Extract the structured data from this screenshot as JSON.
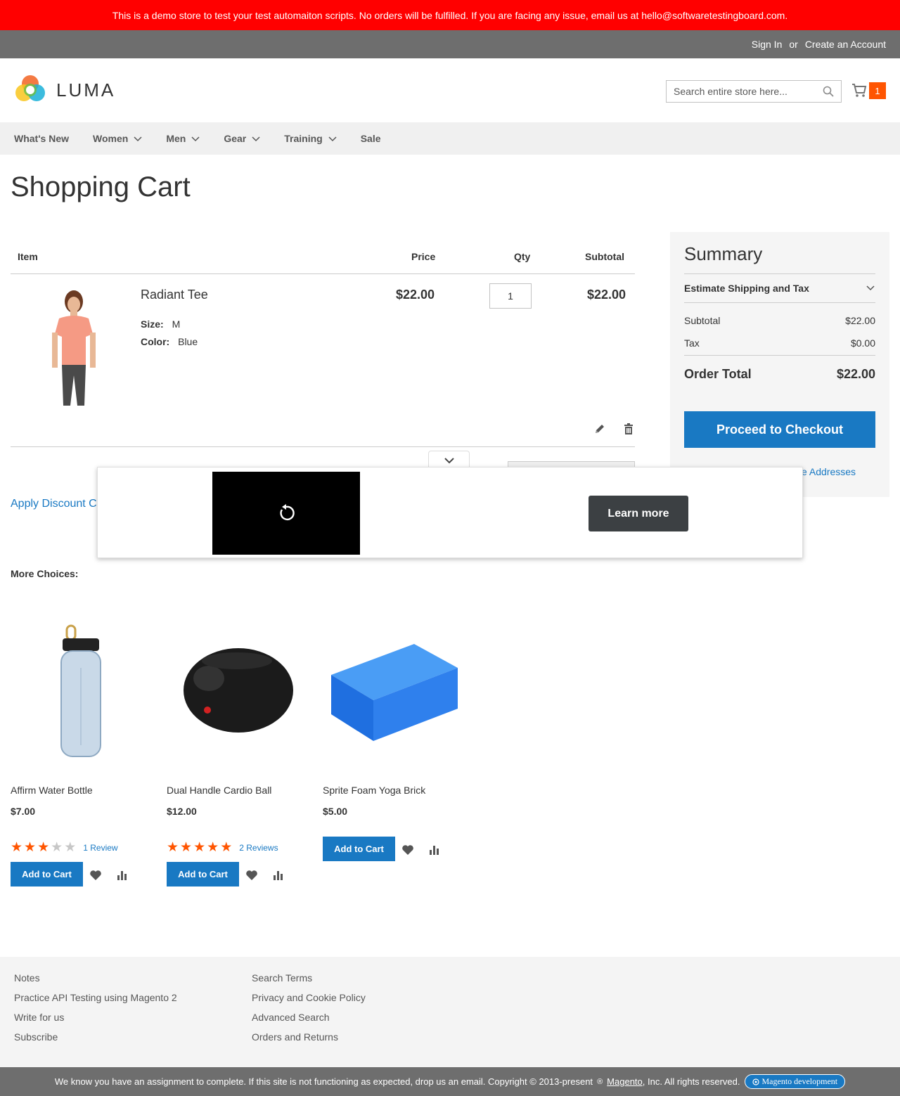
{
  "demo_notice": "This is a demo store to test your test automaiton scripts. No orders will be fulfilled. If you are facing any issue, email us at hello@softwaretestingboard.com.",
  "top_links": {
    "sign_in": "Sign In",
    "or": "or",
    "create_account": "Create an Account"
  },
  "header": {
    "logo_text": "LUMA",
    "search_placeholder": "Search entire store here...",
    "cart_count": "1"
  },
  "nav": {
    "items": [
      {
        "label": "What's New",
        "dropdown": false
      },
      {
        "label": "Women",
        "dropdown": true
      },
      {
        "label": "Men",
        "dropdown": true
      },
      {
        "label": "Gear",
        "dropdown": true
      },
      {
        "label": "Training",
        "dropdown": true
      },
      {
        "label": "Sale",
        "dropdown": false
      }
    ]
  },
  "page_title": "Shopping Cart",
  "cart": {
    "headers": {
      "item": "Item",
      "price": "Price",
      "qty": "Qty",
      "subtotal": "Subtotal"
    },
    "item": {
      "name": "Radiant Tee",
      "size_label": "Size:",
      "size_value": "M",
      "color_label": "Color:",
      "color_value": "Blue",
      "price": "$22.00",
      "qty": "1",
      "subtotal": "$22.00"
    },
    "apply_discount": "Apply Discount C"
  },
  "summary": {
    "title": "Summary",
    "estimate": "Estimate Shipping and Tax",
    "subtotal_label": "Subtotal",
    "subtotal_value": "$22.00",
    "tax_label": "Tax",
    "tax_value": "$0.00",
    "total_label": "Order Total",
    "total_value": "$22.00",
    "checkout": "Proceed to Checkout",
    "multi_address": "e Addresses"
  },
  "ad": {
    "learn_more": "Learn more"
  },
  "more_choices": {
    "title": "More Choices:",
    "products": [
      {
        "name": "Affirm Water Bottle",
        "price": "$7.00",
        "rating": 3,
        "reviews": "1 Review",
        "button": "Add to Cart"
      },
      {
        "name": "Dual Handle Cardio Ball",
        "price": "$12.00",
        "rating": 5,
        "reviews": "2 Reviews",
        "button": "Add to Cart"
      },
      {
        "name": "Sprite Foam Yoga Brick",
        "price": "$5.00",
        "rating": 0,
        "reviews": "",
        "button": "Add to Cart"
      }
    ]
  },
  "footer": {
    "col1": [
      "Notes",
      "Practice API Testing using Magento 2",
      "Write for us",
      "Subscribe"
    ],
    "col2": [
      "Search Terms",
      "Privacy and Cookie Policy",
      "Advanced Search",
      "Orders and Returns"
    ],
    "copyright_before": "We know you have an assignment to complete. If this site is not functioning as expected, drop us an email. Copyright © 2013-present",
    "copyright_brand": "Magento",
    "copyright_after": ", Inc. All rights reserved.",
    "badge": "Magento development"
  },
  "colors": {
    "accent": "#1979c3",
    "demo_bar": "#ff0000",
    "counter": "#ff5501",
    "star": "#ff5501"
  }
}
